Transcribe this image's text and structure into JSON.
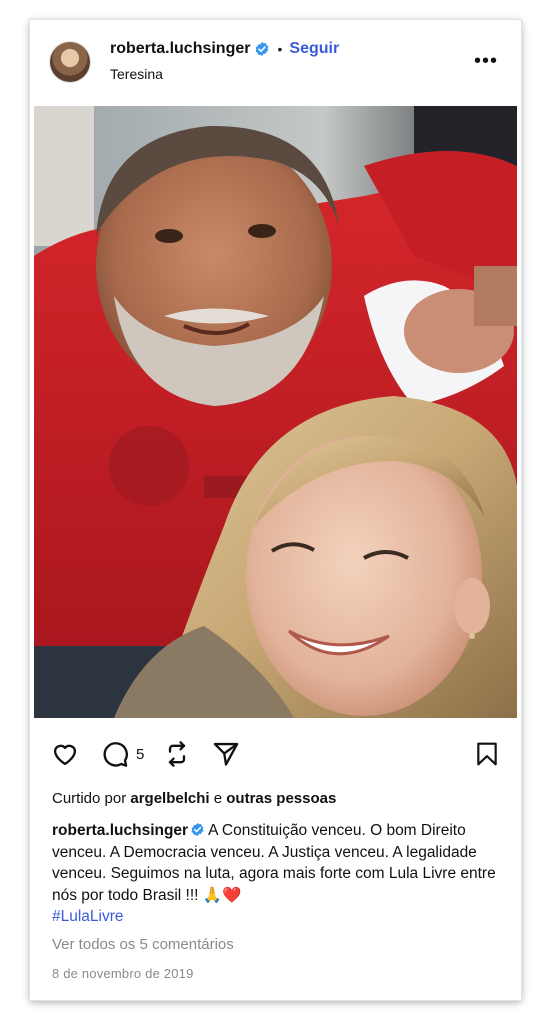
{
  "post": {
    "author": {
      "username": "roberta.luchsinger",
      "verified": true,
      "location": "Teresina"
    },
    "separator": "•",
    "follow_label": "Seguir",
    "more_label": "•••",
    "photo": {
      "description_icon": "user-tag-icon"
    },
    "actions": {
      "like_icon": "heart-icon",
      "comment_icon": "comment-icon",
      "comment_count": "5",
      "repost_icon": "repost-icon",
      "share_icon": "send-icon",
      "save_icon": "bookmark-icon"
    },
    "likes": {
      "prefix": "Curtido por",
      "user": "argelbelchi",
      "connector": "e",
      "others": "outras pessoas"
    },
    "caption": {
      "username": "roberta.luchsinger",
      "text": "A Constituição venceu. O bom Direito venceu. A Democracia venceu. A Justiça venceu. A legalidade venceu. Seguimos na luta, agora mais forte com Lula Livre entre nós por todo Brasil !!! 🙏❤️",
      "hashtag": "#LulaLivre"
    },
    "view_comments": "Ver todos os 5 comentários",
    "date": "8 de novembro de 2019"
  },
  "colors": {
    "link_blue": "#3a5bd9",
    "verified_blue": "#3797f0",
    "muted_text": "#8a8a8a"
  }
}
